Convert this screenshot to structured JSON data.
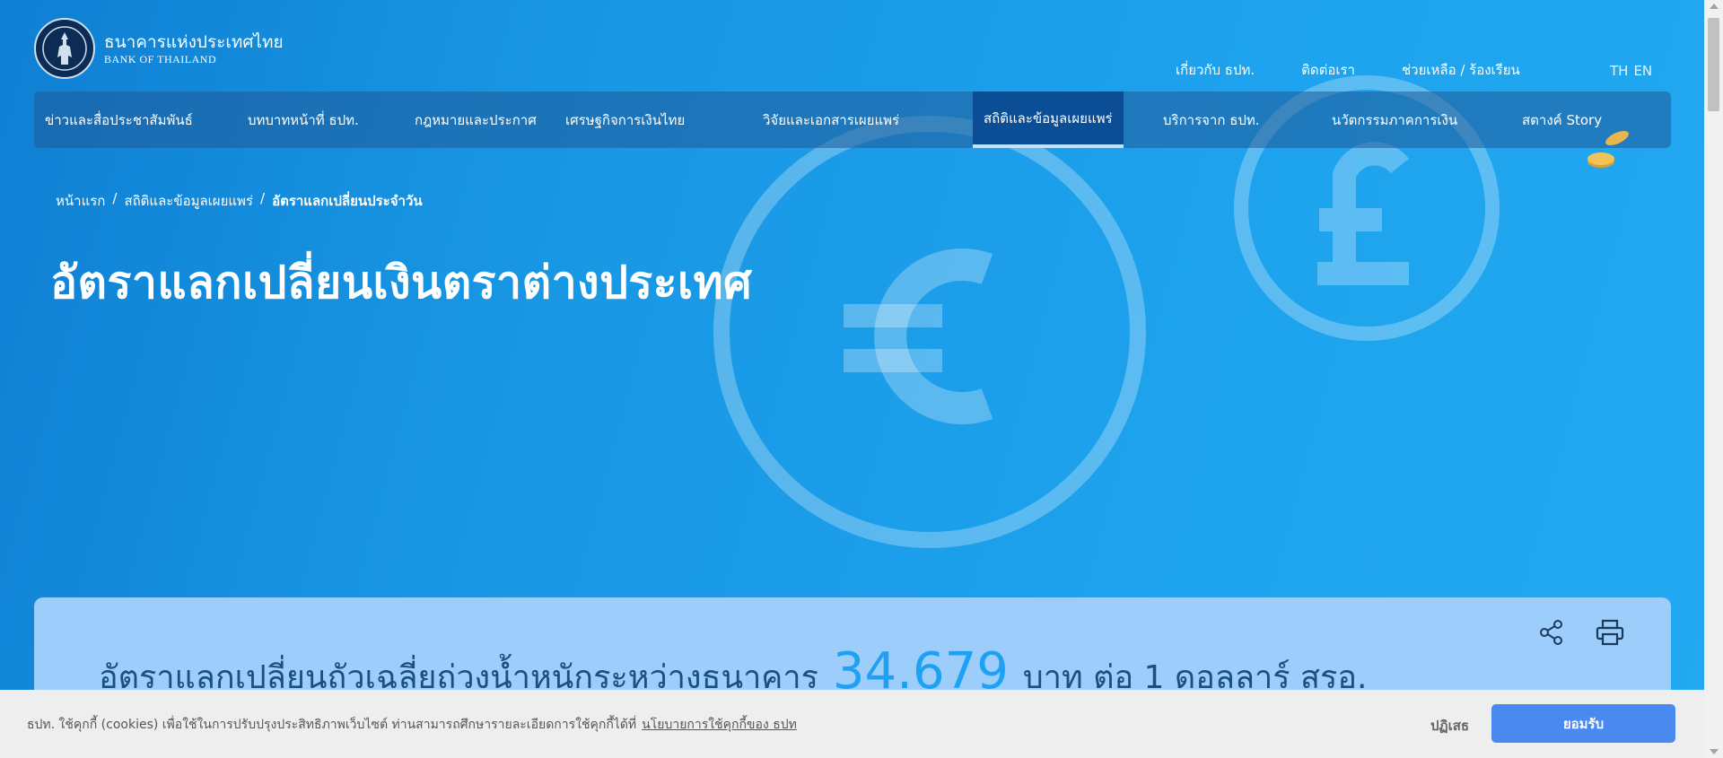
{
  "brand": {
    "name_th": "ธนาคารแห่งประเทศไทย",
    "name_en": "BANK OF THAILAND",
    "logo_icon": "bank-of-thailand-seal"
  },
  "top_links": [
    "เกี่ยวกับ ธปท.",
    "ติดต่อเรา",
    "ช่วยเหลือ / ร้องเรียน"
  ],
  "lang": {
    "th": "TH",
    "en": "EN"
  },
  "nav": {
    "items": [
      "ข่าวและสื่อประชาสัมพันธ์",
      "บทบาทหน้าที่ ธปท.",
      "กฎหมายและประกาศ",
      "เศรษฐกิจการเงินไทย",
      "วิจัยและเอกสารเผยแพร่",
      "สถิติและข้อมูลเผยแพร่",
      "บริการจาก ธปท.",
      "นวัตกรรมภาคการเงิน",
      "สตางค์ Story"
    ],
    "active_index": 5
  },
  "breadcrumb": {
    "home": "หน้าแรก",
    "sep": "/",
    "section": "สถิติและข้อมูลเผยแพร่",
    "current": "อัตราแลกเปลี่ยนประจำวัน"
  },
  "page_title": "อัตราแลกเปลี่ยนเงินตราต่างประเทศ",
  "rate_card": {
    "prefix": "อัตราแลกเปลี่ยนถัวเฉลี่ยถ่วงน้ำหนักระหว่างธนาคาร",
    "value": "34.679",
    "suffix": "บาท ต่อ 1 ดอลลาร์ สรอ.",
    "share_icon": "share-icon",
    "print_icon": "print-icon"
  },
  "cookie": {
    "text": "ธปท. ใช้คุกกี้ (cookies) เพื่อใช้ในการปรับปรุงประสิทธิภาพเว็บไซต์ ท่านสามารถศึกษารายละเอียดการใช้คุกกี้ได้ที่",
    "link": "นโยบายการใช้คุกกี้ของ ธปท",
    "reject": "ปฏิเสธ",
    "accept": "ยอมรับ"
  },
  "colors": {
    "accent": "#1da1f2",
    "nav_active": "#0b4e96",
    "card_bg": "#9dcdfb",
    "accept_button": "#4a8af0"
  }
}
